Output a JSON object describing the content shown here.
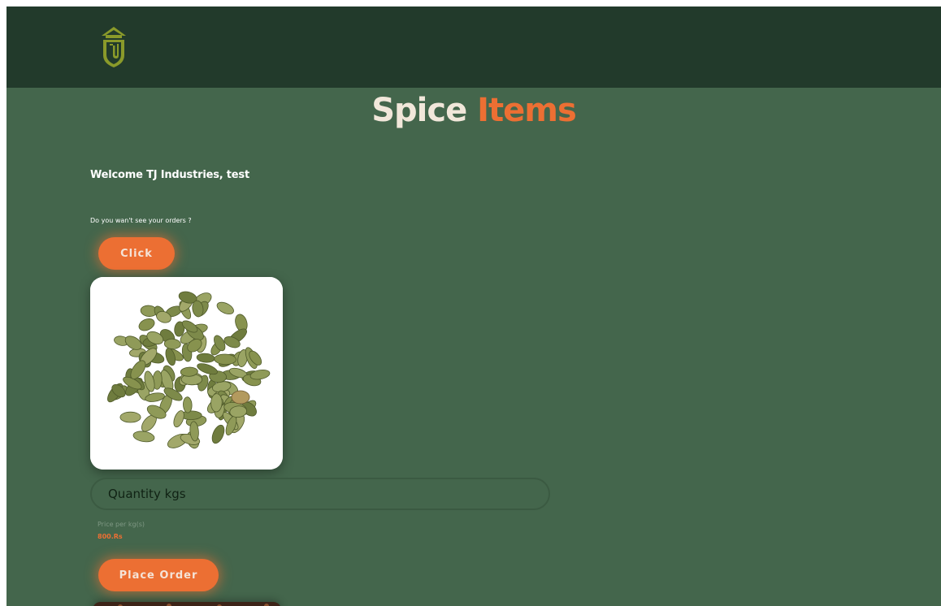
{
  "header": {
    "logo": "tj-shield-logo"
  },
  "title": {
    "word1": "Spice",
    "word2": "Items"
  },
  "welcome_text": "Welcome TJ Industries, test",
  "orders_prompt": "Do you wan't see your orders ?",
  "click_button_label": "Click",
  "product": {
    "image": "green-cardamom-pods",
    "quantity_placeholder": "Quantity kgs",
    "price_label": "Price per kg(s)",
    "price_value": "800.Rs",
    "order_button_label": "Place Order"
  },
  "next_product": {
    "image": "cloves"
  },
  "colors": {
    "header_bg": "#223a2b",
    "page_bg": "#44664c",
    "accent": "#ec6f33",
    "title_light": "#f1e7da",
    "logo": "#8a9a2a"
  }
}
